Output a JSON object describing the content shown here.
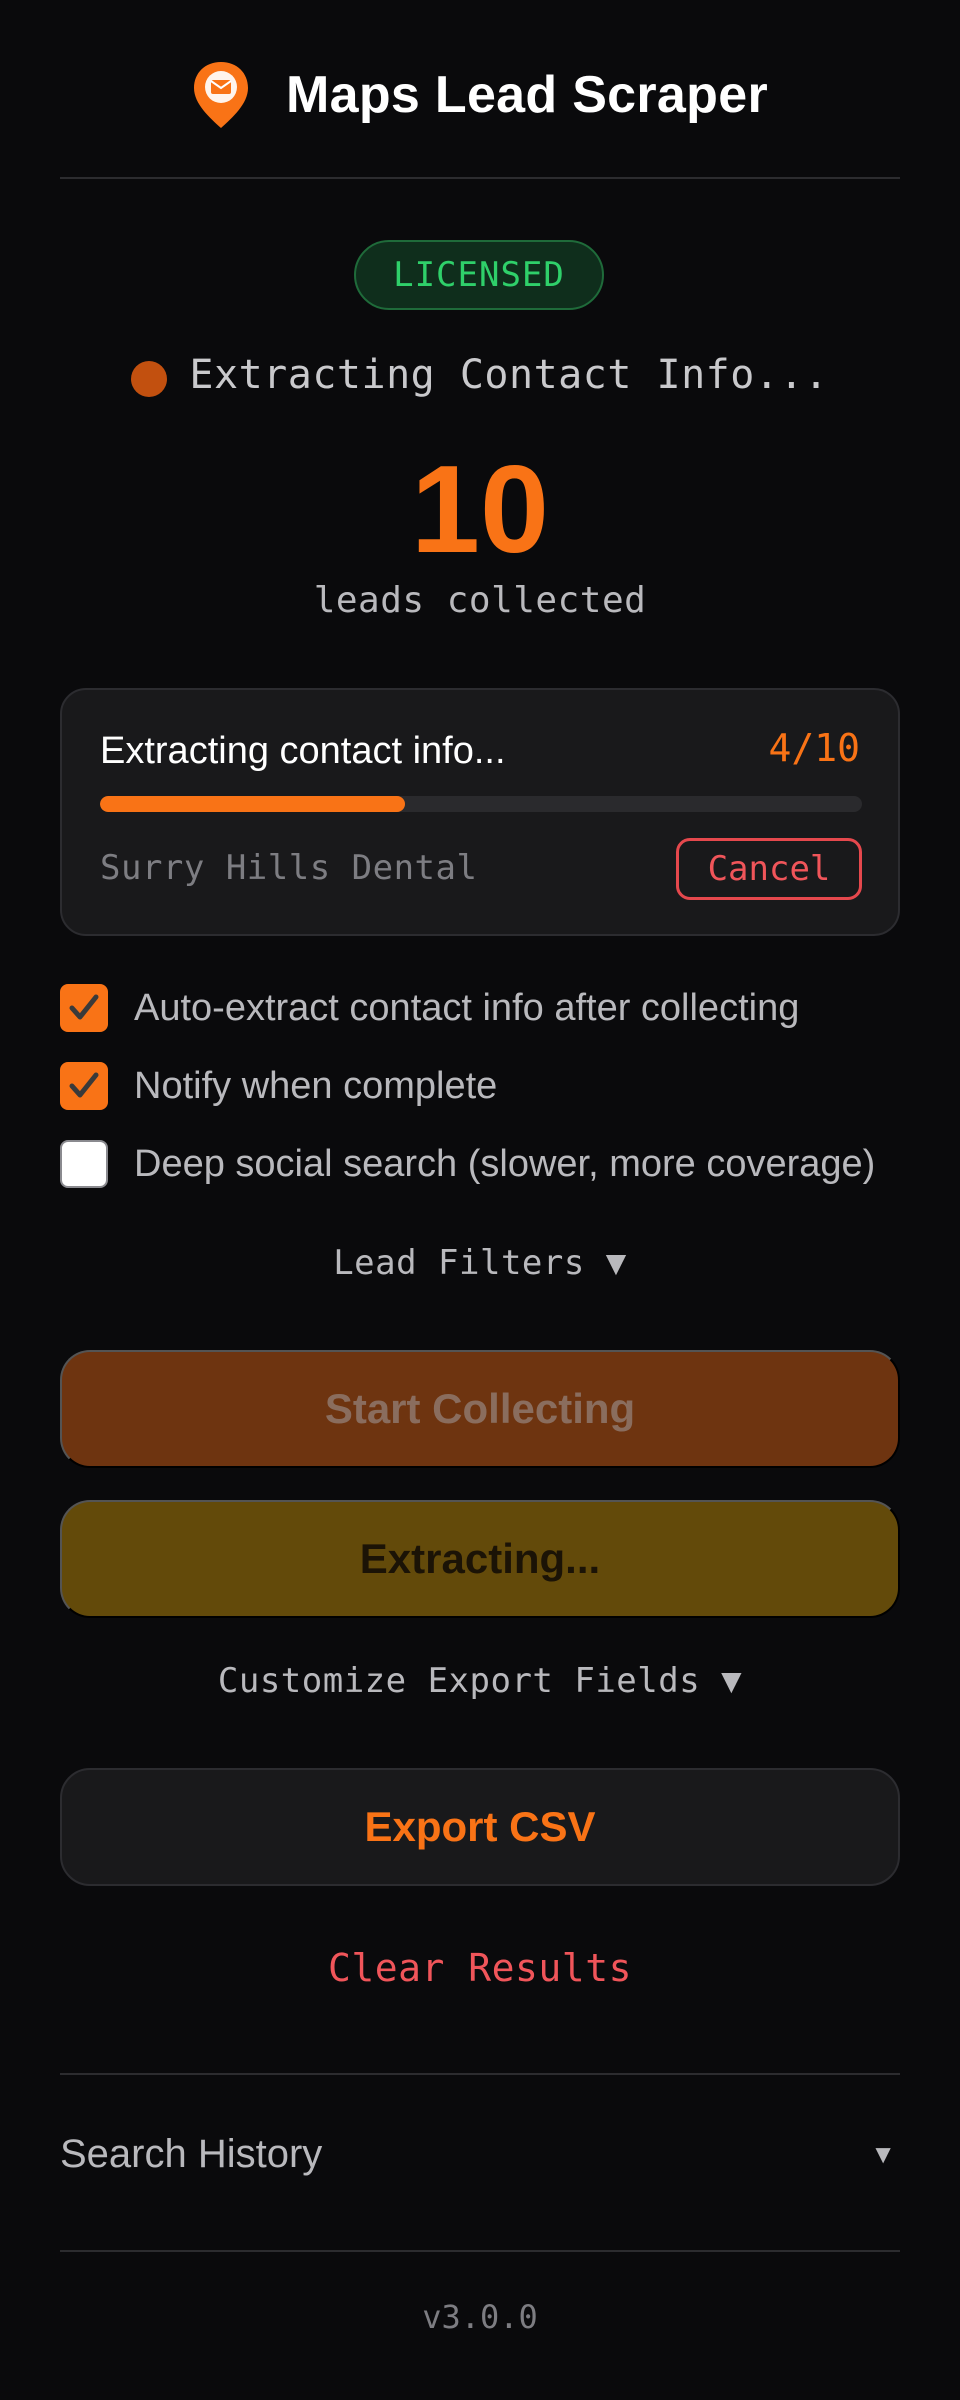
{
  "header": {
    "title": "Maps Lead Scraper",
    "logo_icon": "map-pin-mail-icon"
  },
  "license": {
    "badge": "LICENSED"
  },
  "status": {
    "text": "Extracting Contact Info...",
    "dot_color": "#c2500f"
  },
  "counter": {
    "value": "10",
    "label": "leads collected"
  },
  "progress_card": {
    "title": "Extracting contact info...",
    "progress_text": "4/10",
    "progress_fraction": 0.4,
    "current_item": "Surry Hills Dental",
    "cancel_label": "Cancel"
  },
  "options": [
    {
      "label": "Auto-extract contact info after collecting",
      "checked": true
    },
    {
      "label": "Notify when complete",
      "checked": true
    },
    {
      "label": "Deep social search (slower, more coverage)",
      "checked": false
    }
  ],
  "filters_toggle": "Lead Filters ▼",
  "buttons": {
    "start": "Start Collecting",
    "extracting": "Extracting...",
    "export": "Export CSV"
  },
  "export_fields_toggle": "Customize Export Fields ▼",
  "clear_results": "Clear Results",
  "search_history": {
    "label": "Search History",
    "arrow": "▼"
  },
  "version": "v3.0.0",
  "colors": {
    "accent": "#f97316",
    "license_green": "#2fd06a",
    "danger": "#f0555a",
    "background": "#0a0a0c"
  }
}
